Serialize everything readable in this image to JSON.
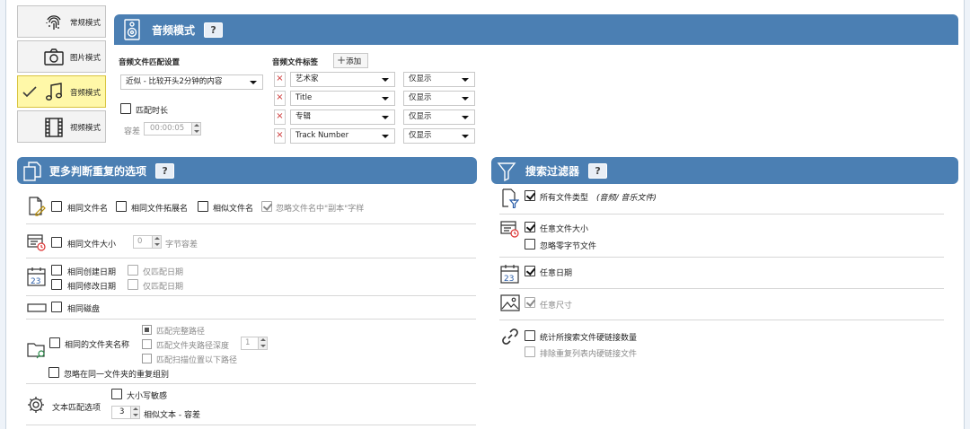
{
  "modes": [
    {
      "label": "常规模式",
      "icon": "fingerprint-icon",
      "active": false
    },
    {
      "label": "图片模式",
      "icon": "camera-icon",
      "active": false
    },
    {
      "label": "音频模式",
      "icon": "music-note-icon",
      "active": true
    },
    {
      "label": "视频模式",
      "icon": "film-icon",
      "active": false
    }
  ],
  "audio": {
    "title": "音频模式",
    "help": "?",
    "match_label": "音频文件匹配设置",
    "match_value": "近似 - 比较开头2分钟的内容",
    "duration_label": "匹配时长",
    "tolerance_label": "容差",
    "tolerance_value": "00:00:05",
    "tags_label": "音频文件标签",
    "add_label": "添加",
    "tags": [
      {
        "name": "艺术家",
        "mode": "仅显示"
      },
      {
        "name": "Title",
        "mode": "仅显示"
      },
      {
        "name": "专辑",
        "mode": "仅显示"
      },
      {
        "name": "Track Number",
        "mode": "仅显示"
      }
    ]
  },
  "more": {
    "title": "更多判断重复的选项",
    "help": "?",
    "same_name": "相同文件名",
    "same_ext": "相同文件拓展名",
    "similar_name": "相似文件名",
    "ignore_copy": "忽略文件名中\"副本\"字样",
    "same_size": "相同文件大小",
    "size_value": "0",
    "size_unit": "字节容差",
    "same_created": "相同创建日期",
    "same_modified": "相同修改日期",
    "date_only_1": "仅匹配日期",
    "date_only_2": "仅匹配日期",
    "same_disk": "相同磁盘",
    "same_folder": "相同的文件夹名称",
    "match_full_path": "匹配完整路径",
    "match_folder_depth": "匹配文件夹路径深度",
    "depth_value": "1",
    "match_below_scan": "匹配扫描位置以下路径",
    "ignore_same_folder": "忽略在同一文件夹的重复组别",
    "text_options": "文本匹配选项",
    "case_sensitive": "大小写敏感",
    "similar_value": "3",
    "similar_text": "相似文本 - 容差"
  },
  "filter": {
    "title": "搜索过滤器",
    "help": "?",
    "all_types": "所有文件类型",
    "all_types_hint": "(音频/ 音乐文件)",
    "any_size": "任意文件大小",
    "ignore_zero": "忽略零字节文件",
    "any_date": "任意日期",
    "any_dims": "任意尺寸",
    "count_hardlinks": "统计所搜索文件硬链接数量",
    "exclude_hardlinks": "排除重复列表内硬链接文件"
  },
  "colors": {
    "header": "#4b7fb3",
    "active_tab": "#fff8a8"
  }
}
